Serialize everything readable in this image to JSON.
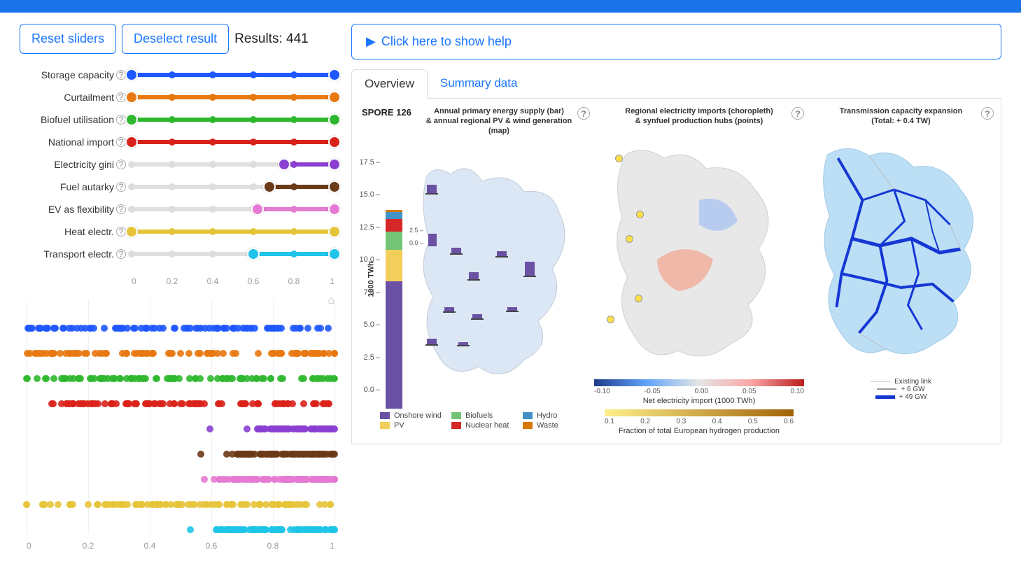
{
  "buttons": {
    "reset": "Reset sliders",
    "deselect": "Deselect result"
  },
  "results_label": "Results: 441",
  "help_toggle": "Click here to show help",
  "tabs": {
    "overview": "Overview",
    "summary": "Summary data"
  },
  "spore_title": "SPORE 126",
  "sliders": {
    "ticks": [
      "0",
      "0.2",
      "0.4",
      "0.6",
      "0.8",
      "1"
    ],
    "rows": [
      {
        "label": "Storage capacity",
        "color": "#1f58ff",
        "range": [
          0,
          1
        ]
      },
      {
        "label": "Curtailment",
        "color": "#e8780f",
        "range": [
          0,
          1
        ]
      },
      {
        "label": "Biofuel utilisation",
        "color": "#2fb82f",
        "range": [
          0,
          1
        ]
      },
      {
        "label": "National import",
        "color": "#d9221b",
        "range": [
          0,
          1
        ]
      },
      {
        "label": "Electricity gini",
        "color": "#8a3fd1",
        "range": [
          0.75,
          1
        ]
      },
      {
        "label": "Fuel autarky",
        "color": "#6b3a17",
        "range": [
          0.68,
          1
        ]
      },
      {
        "label": "EV as flexibility",
        "color": "#e47ad1",
        "range": [
          0.62,
          1
        ]
      },
      {
        "label": "Heat electr.",
        "color": "#e5c43a",
        "range": [
          0,
          1
        ]
      },
      {
        "label": "Transport electr.",
        "color": "#1fc4e8",
        "range": [
          0.6,
          1
        ]
      }
    ]
  },
  "scatter": {
    "ticks": [
      "0",
      "0.2",
      "0.4",
      "0.6",
      "0.8",
      "1"
    ]
  },
  "chart_titles": {
    "c1": "Annual primary energy supply (bar)\n& annual regional PV & wind generation (map)",
    "c2": "Regional electricity imports (choropleth)\n& synfuel production hubs (points)",
    "c3": "Transmission capacity expansion\n(Total: + 0.4 TW)"
  },
  "chart_data": {
    "supply_bar": {
      "type": "bar",
      "ylabel": "1000 TWh",
      "yticks": [
        "0.0",
        "2.5",
        "5.0",
        "7.5",
        "10.0",
        "12.5",
        "15.0",
        "17.5"
      ],
      "ylim": [
        0,
        17.5
      ],
      "series_stack": [
        {
          "name": "Onshore wind",
          "color": "#6a51a3",
          "value": 9.8
        },
        {
          "name": "PV",
          "color": "#f2cf5b",
          "value": 2.4
        },
        {
          "name": "Biofuels",
          "color": "#74c476",
          "value": 1.4
        },
        {
          "name": "Nuclear heat",
          "color": "#d62728",
          "value": 1.0
        },
        {
          "name": "Hydro",
          "color": "#4292c6",
          "value": 0.5
        },
        {
          "name": "Waste",
          "color": "#d97706",
          "value": 0.2
        }
      ],
      "minibar_yticks": [
        "0.0",
        "2.5"
      ],
      "minibar_ylabel": "1000 TWh"
    },
    "import_gradient": {
      "ticks": [
        "-0.10",
        "-0.05",
        "0.00",
        "0.05",
        "0.10"
      ],
      "label": "Net electricity import (1000 TWh)"
    },
    "hydrogen_gradient": {
      "ticks": [
        "0.1",
        "0.2",
        "0.3",
        "0.4",
        "0.5",
        "0.6"
      ],
      "label": "Fraction of total European hydrogen production"
    },
    "transmission_legend": {
      "items": [
        {
          "label": "Existing link",
          "color": "#cccccc",
          "weight": 1
        },
        {
          "label": "+ 6 GW",
          "color": "#999999",
          "weight": 2
        },
        {
          "label": "+ 49 GW",
          "color": "#1537d4",
          "weight": 5
        }
      ]
    }
  },
  "legend_supply": [
    {
      "label": "Onshore wind",
      "color": "#6a51a3"
    },
    {
      "label": "Biofuels",
      "color": "#74c476"
    },
    {
      "label": "Hydro",
      "color": "#4292c6"
    },
    {
      "label": "PV",
      "color": "#f2cf5b"
    },
    {
      "label": "Nuclear heat",
      "color": "#d62728"
    },
    {
      "label": "Waste",
      "color": "#d97706"
    }
  ]
}
